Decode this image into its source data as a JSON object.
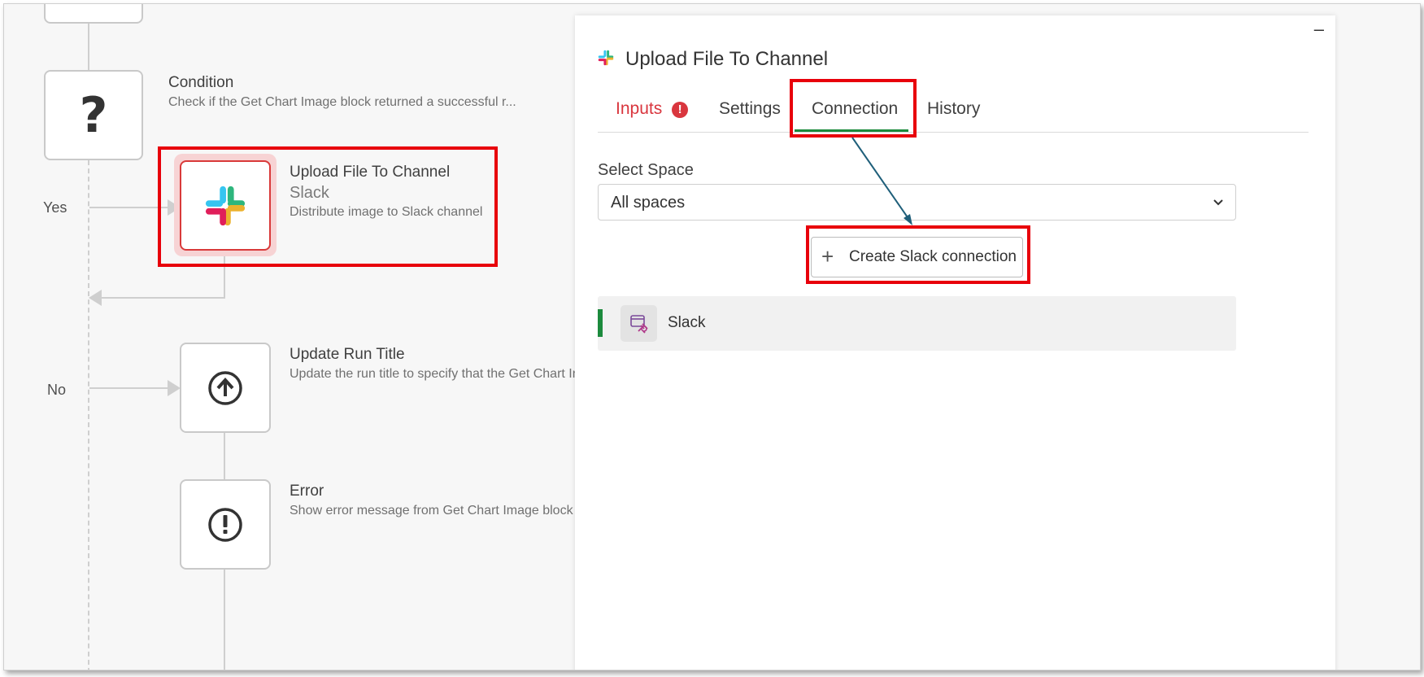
{
  "canvas": {
    "blocks": [
      {
        "title": "Condition",
        "description": "Check if the Get Chart Image block returned a successful r...",
        "icon": "question-icon"
      },
      {
        "title": "Upload File To Channel",
        "subtitle": "Slack",
        "description": "Distribute image to Slack channel",
        "icon": "slack-logo-icon"
      },
      {
        "title": "Update Run Title",
        "description": "Update the run title to specify that the Get Chart In",
        "icon": "upload-circle-icon"
      },
      {
        "title": "Error",
        "description": "Show  error message from Get Chart Image block a",
        "icon": "exclamation-circle-icon"
      }
    ],
    "branches": {
      "yes": "Yes",
      "no": "No"
    }
  },
  "panel": {
    "title": "Upload File To Channel",
    "minimize": "–",
    "tabs": [
      {
        "label": "Inputs",
        "state": "error"
      },
      {
        "label": "Settings"
      },
      {
        "label": "Connection",
        "state": "active"
      },
      {
        "label": "History"
      }
    ],
    "select_space": {
      "label": "Select Space",
      "value": "All spaces"
    },
    "create_button": {
      "icon": "+",
      "label": "Create Slack connection"
    },
    "connections": [
      {
        "label": "Slack",
        "icon": "connection-plug-icon"
      }
    ]
  },
  "colors": {
    "highlight": "#e8000b",
    "active_tab": "#1c8a3d",
    "error_tab": "#d9363e",
    "annotation_arrow": "#1f5f7a"
  }
}
